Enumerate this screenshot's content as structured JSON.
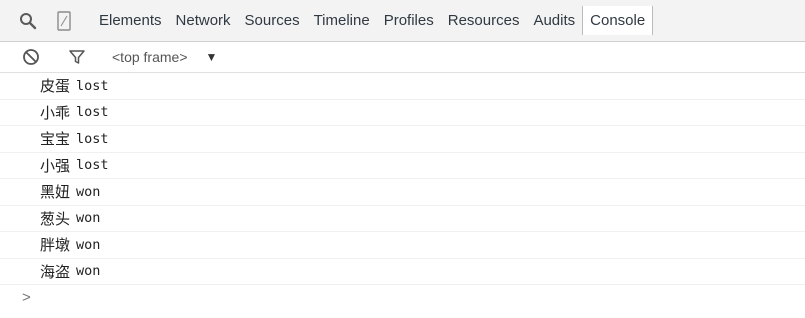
{
  "toolbar": {
    "tabs": [
      {
        "label": "Elements"
      },
      {
        "label": "Network"
      },
      {
        "label": "Sources"
      },
      {
        "label": "Timeline"
      },
      {
        "label": "Profiles"
      },
      {
        "label": "Resources"
      },
      {
        "label": "Audits"
      },
      {
        "label": "Console"
      }
    ],
    "active_tab": "Console"
  },
  "filterbar": {
    "frame_label": "<top frame>",
    "frame_arrow": "▼"
  },
  "console": {
    "rows": [
      {
        "name": "皮蛋",
        "result": "lost"
      },
      {
        "name": "小乖",
        "result": "lost"
      },
      {
        "name": "宝宝",
        "result": "lost"
      },
      {
        "name": "小强",
        "result": "lost"
      },
      {
        "name": "黑妞",
        "result": "won"
      },
      {
        "name": "葱头",
        "result": "won"
      },
      {
        "name": "胖墩",
        "result": "won"
      },
      {
        "name": "海盗",
        "result": "won"
      }
    ],
    "prompt": ">"
  },
  "icons": {
    "search": "search-icon",
    "device": "device-mode-icon",
    "clear": "clear-console-icon",
    "filter": "filter-icon"
  }
}
